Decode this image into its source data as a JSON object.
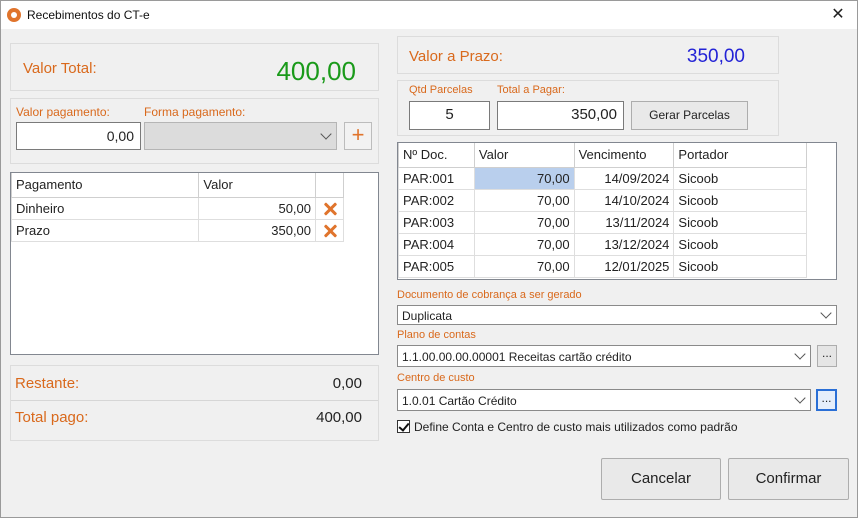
{
  "window": {
    "title": "Recebimentos do CT-e",
    "close_symbol": "✕"
  },
  "valor_total": {
    "label": "Valor Total:",
    "value": "400,00"
  },
  "pagamento": {
    "valor_label": "Valor pagamento:",
    "valor_value": "0,00",
    "forma_label": "Forma pagamento:",
    "forma_value": "",
    "add_symbol": "+"
  },
  "payments_table": {
    "headers": [
      "Pagamento",
      "Valor"
    ],
    "rows": [
      {
        "name": "Dinheiro",
        "value": "50,00"
      },
      {
        "name": "Prazo",
        "value": "350,00"
      }
    ]
  },
  "summary": {
    "restante_label": "Restante:",
    "restante_value": "0,00",
    "total_pago_label": "Total pago:",
    "total_pago_value": "400,00"
  },
  "prazo": {
    "label": "Valor a Prazo:",
    "value": "350,00"
  },
  "parcelas": {
    "qtd_label": "Qtd Parcelas",
    "qtd_value": "5",
    "total_label": "Total a Pagar:",
    "total_value": "350,00",
    "gerar_label": "Gerar Parcelas"
  },
  "installments_table": {
    "headers": [
      "Nº Doc.",
      "Valor",
      "Vencimento",
      "Portador"
    ],
    "rows": [
      {
        "doc": "PAR:001",
        "valor": "70,00",
        "venc": "14/09/2024",
        "portador": "Sicoob"
      },
      {
        "doc": "PAR:002",
        "valor": "70,00",
        "venc": "14/10/2024",
        "portador": "Sicoob"
      },
      {
        "doc": "PAR:003",
        "valor": "70,00",
        "venc": "13/11/2024",
        "portador": "Sicoob"
      },
      {
        "doc": "PAR:004",
        "valor": "70,00",
        "venc": "13/12/2024",
        "portador": "Sicoob"
      },
      {
        "doc": "PAR:005",
        "valor": "70,00",
        "venc": "12/01/2025",
        "portador": "Sicoob"
      }
    ]
  },
  "documento": {
    "label": "Documento de cobrança a ser gerado",
    "value": "Duplicata"
  },
  "plano": {
    "label": "Plano de contas",
    "value": "1.1.00.00.00.00001  Receitas cartão crédito",
    "ellipsis": "..."
  },
  "centro": {
    "label": "Centro de custo",
    "value": "1.0.01  Cartão Crédito",
    "ellipsis": "..."
  },
  "default_checkbox": {
    "label": "Define Conta e Centro de custo mais utilizados como padrão",
    "checked": true
  },
  "buttons": {
    "cancel": "Cancelar",
    "confirm": "Confirmar"
  },
  "colors": {
    "accent": "#d9691c",
    "green": "#1a9a1a",
    "blue": "#2323d6",
    "selection": "#c5d5ea"
  }
}
